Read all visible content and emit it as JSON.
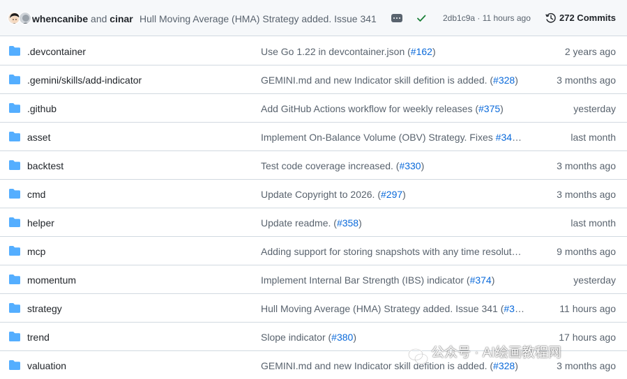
{
  "latest_commit": {
    "author1": "whencanibe",
    "joiner": "and",
    "author2": "cinar",
    "message": "Hull Moving Average (HMA) Strategy added. Issue 341",
    "status": "success",
    "hash_time": "2db1c9a · 11 hours ago",
    "commits_label": "272 Commits"
  },
  "rows": [
    {
      "name": ".devcontainer",
      "msg": "Use Go 1.22 in devcontainer.json (",
      "link": "#162",
      "after": ")",
      "time": "2 years ago"
    },
    {
      "name": ".gemini/skills/add-indicator",
      "msg": "GEMINI.md and new Indicator skill defition is added. (",
      "link": "#328",
      "after": ")",
      "time": "3 months ago"
    },
    {
      "name": ".github",
      "msg": "Add GitHub Actions workflow for weekly releases (",
      "link": "#375",
      "after": ")",
      "time": "yesterday"
    },
    {
      "name": "asset",
      "msg": "Implement On-Balance Volume (OBV) Strategy. Fixes ",
      "link": "#34",
      "after": "…",
      "time": "last month"
    },
    {
      "name": "backtest",
      "msg": "Test code coverage increased. (",
      "link": "#330",
      "after": ")",
      "time": "3 months ago"
    },
    {
      "name": "cmd",
      "msg": "Update Copyright to 2026. (",
      "link": "#297",
      "after": ")",
      "time": "3 months ago"
    },
    {
      "name": "helper",
      "msg": "Update readme. (",
      "link": "#358",
      "after": ")",
      "time": "last month"
    },
    {
      "name": "mcp",
      "msg": "Adding support for storing snapshots with any time resolut…",
      "link": "",
      "after": "",
      "time": "9 months ago"
    },
    {
      "name": "momentum",
      "msg": "Implement Internal Bar Strength (IBS) indicator (",
      "link": "#374",
      "after": ")",
      "time": "yesterday"
    },
    {
      "name": "strategy",
      "msg": "Hull Moving Average (HMA) Strategy added. Issue 341 (",
      "link": "#3",
      "after": "…",
      "time": "11 hours ago"
    },
    {
      "name": "trend",
      "msg": "Slope indicator (",
      "link": "#380",
      "after": ")",
      "time": "17 hours ago"
    },
    {
      "name": "valuation",
      "msg": "GEMINI.md and new Indicator skill defition is added. (",
      "link": "#328",
      "after": ")",
      "time": "3 months ago"
    }
  ],
  "watermark": "公众号 · AI绘画教程网",
  "colors": {
    "folder": "#54aeff",
    "link": "#0969da",
    "check": "#1a7f37",
    "muted": "#59636e"
  }
}
